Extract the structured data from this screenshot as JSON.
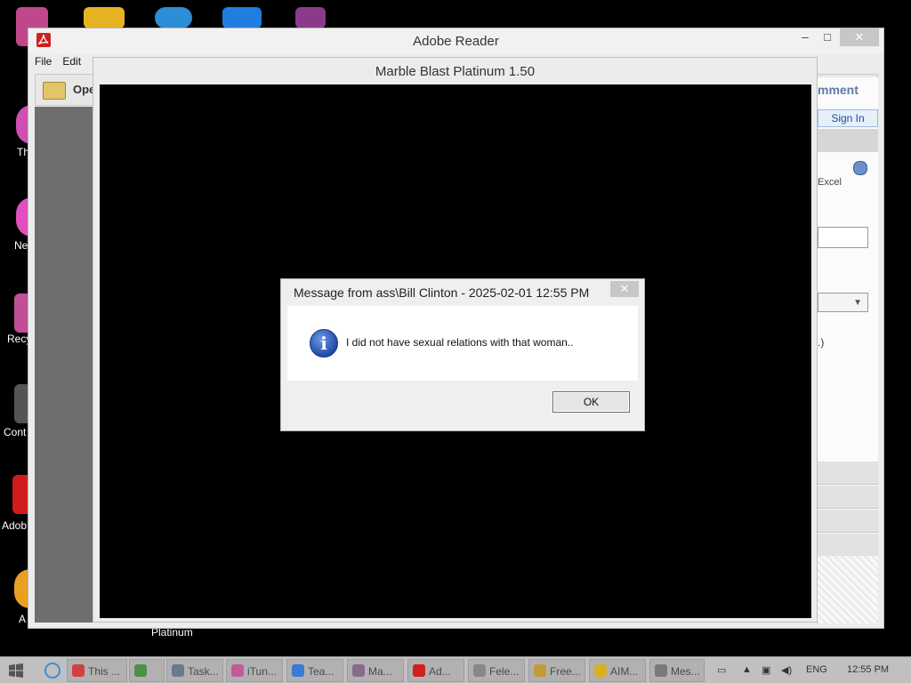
{
  "desktop": {
    "icons": [
      {
        "label": "Th"
      },
      {
        "label": "Ne"
      },
      {
        "label": "Recy"
      },
      {
        "label": "Cont"
      },
      {
        "label": "Adob"
      },
      {
        "label": "A"
      }
    ],
    "caption_below_window": "Platinum"
  },
  "reader_window": {
    "title": "Adobe Reader",
    "menu": [
      "File",
      "Edit"
    ],
    "toolbar_open": "Ope",
    "right_pane": {
      "comment_label": "mment",
      "sign_in": "Sign In",
      "excel_label": "Excel",
      "paren_text": ".)"
    },
    "controls": {
      "minimize": "–",
      "maximize": "□",
      "close": "✕"
    }
  },
  "game_window": {
    "title": "Marble Blast Platinum 1.50"
  },
  "dialog": {
    "title": "Message from ass\\Bill Clinton - 2025-02-01 12:55 PM",
    "message": "I did not have sexual relations with that woman..",
    "ok_label": "OK",
    "close_label": "✕"
  },
  "taskbar": {
    "tasks": [
      {
        "label": "This ...",
        "icon_color": "#d04040"
      },
      {
        "label": "",
        "icon_color": "#4b8f4b"
      },
      {
        "label": "Task...",
        "icon_color": "#6a7a8f"
      },
      {
        "label": "iTun...",
        "icon_color": "#c45a9a"
      },
      {
        "label": "Tea...",
        "icon_color": "#3a7bd5"
      },
      {
        "label": "Ma...",
        "icon_color": "#8a6a8a"
      },
      {
        "label": "Ad...",
        "icon_color": "#cf1f1f"
      },
      {
        "label": "Fele...",
        "icon_color": "#888888"
      },
      {
        "label": "Free...",
        "icon_color": "#c29a3a"
      },
      {
        "label": "AIM...",
        "icon_color": "#d9b020"
      },
      {
        "label": "Mes...",
        "icon_color": "#7a7a7a"
      }
    ],
    "language": "ENG",
    "time": "12:55 PM"
  }
}
